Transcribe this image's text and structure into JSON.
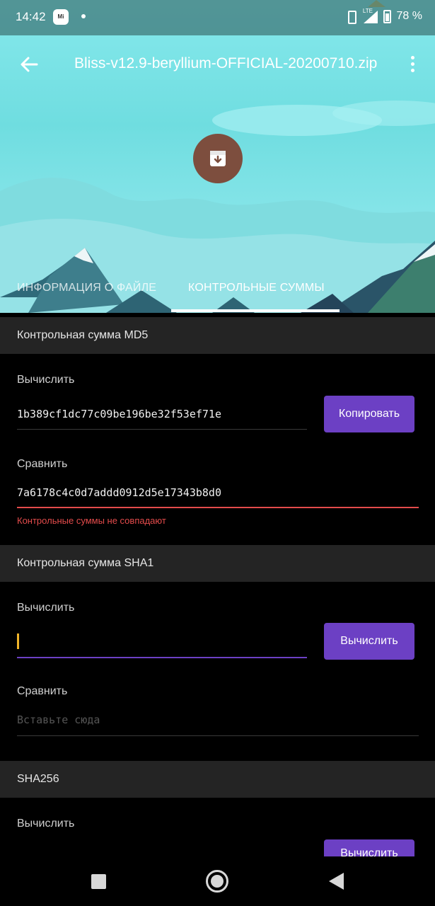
{
  "status_bar": {
    "time": "14:42",
    "mi_badge": "Mi",
    "network": "LTE",
    "battery": "78 %"
  },
  "app_bar": {
    "title": "Bliss-v12.9-beryllium-OFFICIAL-20200710.zip",
    "back_icon": "arrow-left-icon",
    "menu_icon": "more-vert-icon"
  },
  "header_icon": "archive-download-icon",
  "tabs": [
    {
      "label": "ИНФОРМАЦИЯ О ФАЙЛЕ",
      "active": false
    },
    {
      "label": "КОНТРОЛЬНЫЕ СУММЫ",
      "active": true
    }
  ],
  "sections": [
    {
      "title": "Контрольная сумма MD5",
      "compute_label": "Вычислить",
      "compute_value": "1b389cf1dc77c09be196be32f53ef71e",
      "button_label": "Копировать",
      "compare_label": "Сравнить",
      "compare_value": "7a6178c4c0d7addd0912d5e17343b8d0",
      "error_text": "Контрольные суммы не совпадают"
    },
    {
      "title": "Контрольная сумма SHA1",
      "compute_label": "Вычислить",
      "compute_value": "",
      "button_label": "Вычислить",
      "compare_label": "Сравнить",
      "compare_placeholder": "Вставьте сюда"
    },
    {
      "title": "SHA256",
      "compute_label": "Вычислить",
      "button_label": "Вычислить"
    }
  ],
  "colors": {
    "accent": "#6c40c4",
    "error": "#e34b4b",
    "cursor": "#f0b429",
    "archive_circle": "#7d4e3e"
  }
}
